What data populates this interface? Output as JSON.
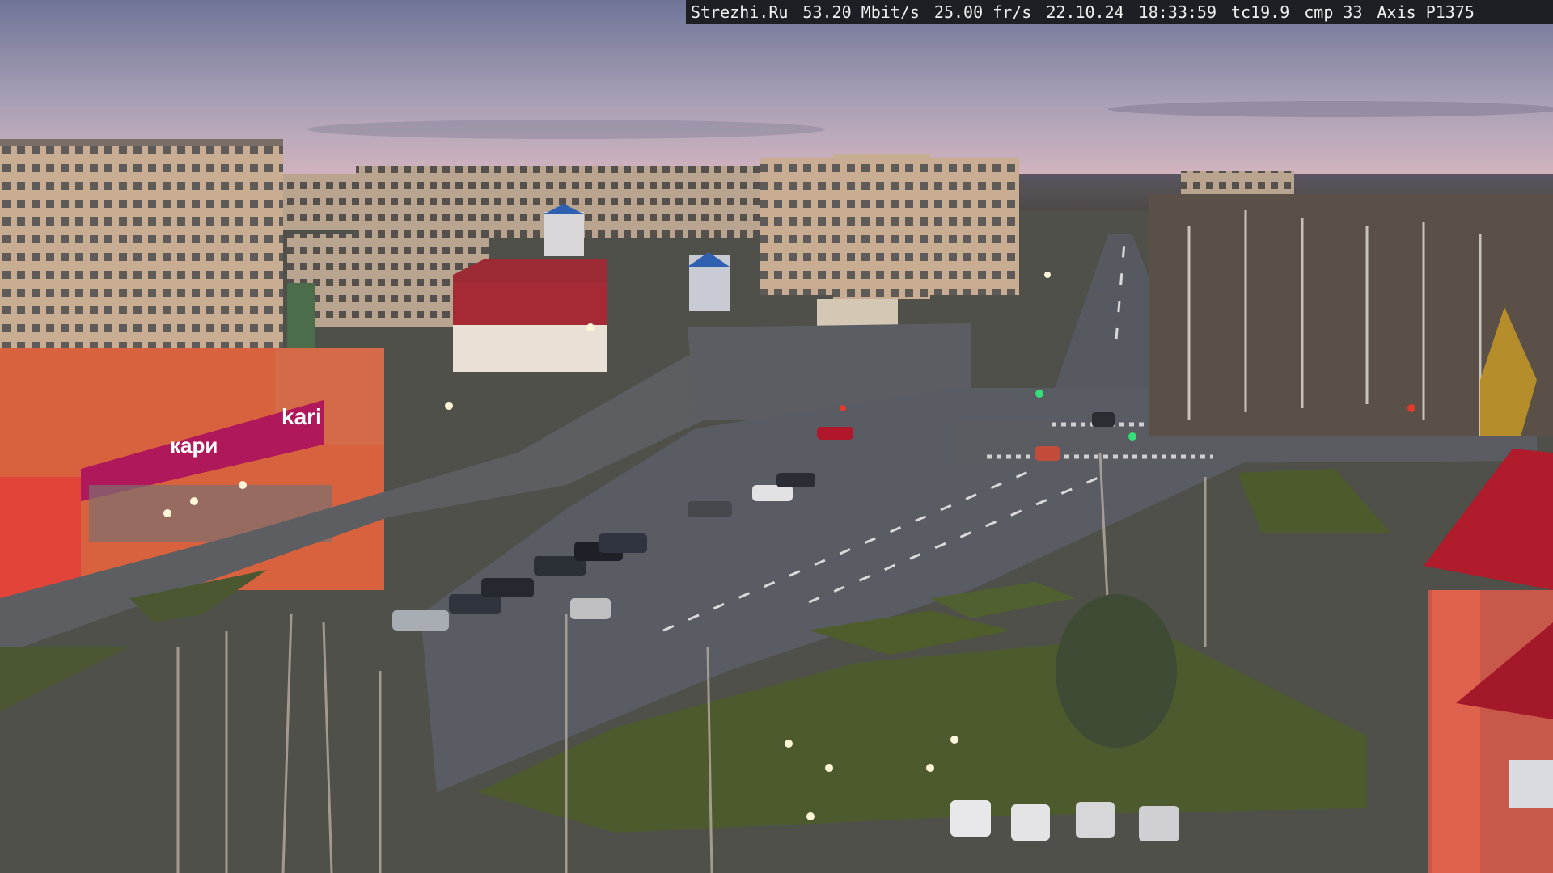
{
  "overlay": {
    "site": "Strezhi.Ru",
    "bitrate": "53.20 Mbit/s",
    "fps": "25.00 fr/s",
    "date": "22.10.24",
    "time": "18:33:59",
    "tc": "tc19.9",
    "cmp": "cmp 33",
    "camera": "Axis P1375"
  },
  "signs": {
    "store_main": "kari",
    "store_banner": "кари",
    "store_small": "kari"
  },
  "colors": {
    "sky_top": "#6e7196",
    "sky_horizon": "#d9b3bf",
    "road": "#5b5e66",
    "grass": "#4e5a2e",
    "store_orange": "#d9613f",
    "store_magenta": "#b0185c",
    "church_red": "#b01c2c"
  }
}
